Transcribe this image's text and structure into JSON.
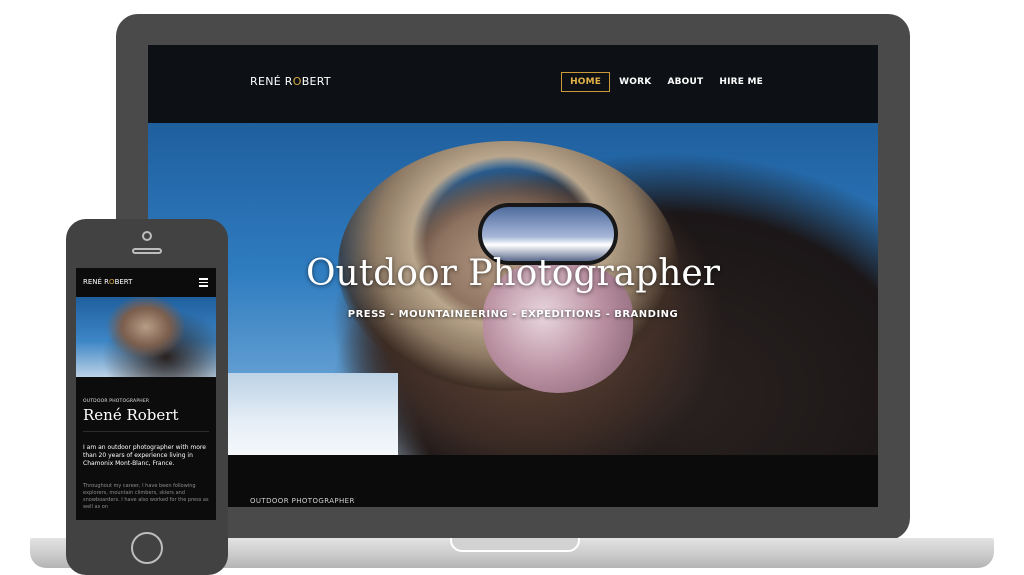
{
  "desktop": {
    "brand": {
      "before": "RENÉ R",
      "accent": "O",
      "after": "BERT"
    },
    "nav": [
      {
        "label": "HOME",
        "active": true
      },
      {
        "label": "WORK",
        "active": false
      },
      {
        "label": "ABOUT",
        "active": false
      },
      {
        "label": "HIRE ME",
        "active": false
      }
    ],
    "hero": {
      "title": "Outdoor Photographer",
      "subtitle": "PRESS - MOUNTAINEERING - EXPEDITIONS - BRANDING"
    },
    "section_label": "OUTDOOR PHOTOGRAPHER"
  },
  "mobile": {
    "brand": {
      "before": "RENÉ R",
      "accent": "O",
      "after": "BERT"
    },
    "label": "OUTDOOR PHOTOGRAPHER",
    "name": "René Robert",
    "intro": "I am an outdoor photographer with more than 20 years of experience living in Chamonix Mont-Blanc, France.",
    "body": "Throughout my career, I have been following explorers, mountain climbers, skiers and snowboarders. I have also worked for the press as well as on"
  },
  "colors": {
    "accent": "#d6a93b",
    "frame": "#4a4a4a",
    "header": "#0d1116"
  }
}
